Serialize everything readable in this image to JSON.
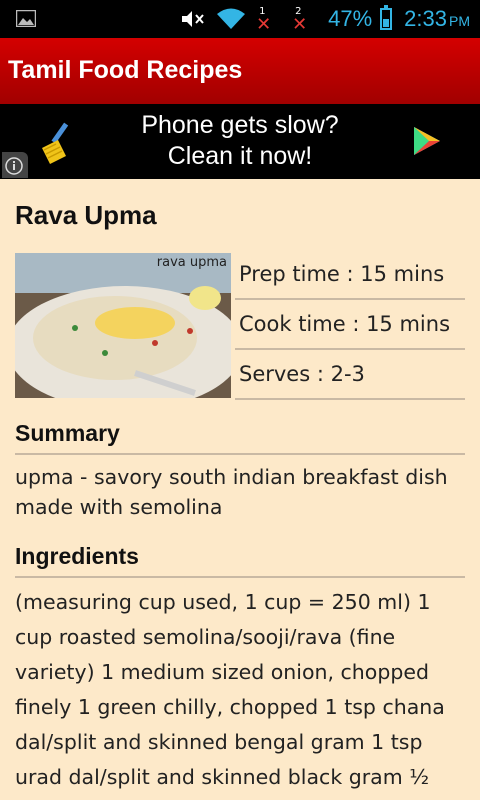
{
  "status_bar": {
    "sim1_label": "1",
    "sim2_label": "2",
    "no_signal_mark": "✕",
    "battery_percent": "47%",
    "battery_level": 0.47,
    "time": "2:33",
    "ampm": "PM",
    "accent_color": "#33b5e5"
  },
  "app_bar": {
    "title": "Tamil Food Recipes",
    "color": "#c40000"
  },
  "ad": {
    "line1": "Phone gets slow?",
    "line2": "Clean it now!"
  },
  "recipe": {
    "title": "Rava Upma",
    "image_caption": "rava upma",
    "prep_time": "Prep time : 15 mins",
    "cook_time": "Cook time : 15 mins",
    "serves": "Serves : 2-3",
    "summary_heading": "Summary",
    "summary_text": "upma - savory south indian breakfast dish made with semolina",
    "ingredients_heading": "Ingredients",
    "ingredients_lines": [
      "(measuring cup used, 1 cup = 250 ml) 1",
      "cup roasted semolina/sooji/rava (fine",
      "variety) 1 medium sized onion, chopped",
      "finely 1 green chilly, chopped 1 tsp chana",
      "dal/split and skinned bengal gram 1 tsp",
      "urad dal/split and skinned black gram ½"
    ]
  }
}
